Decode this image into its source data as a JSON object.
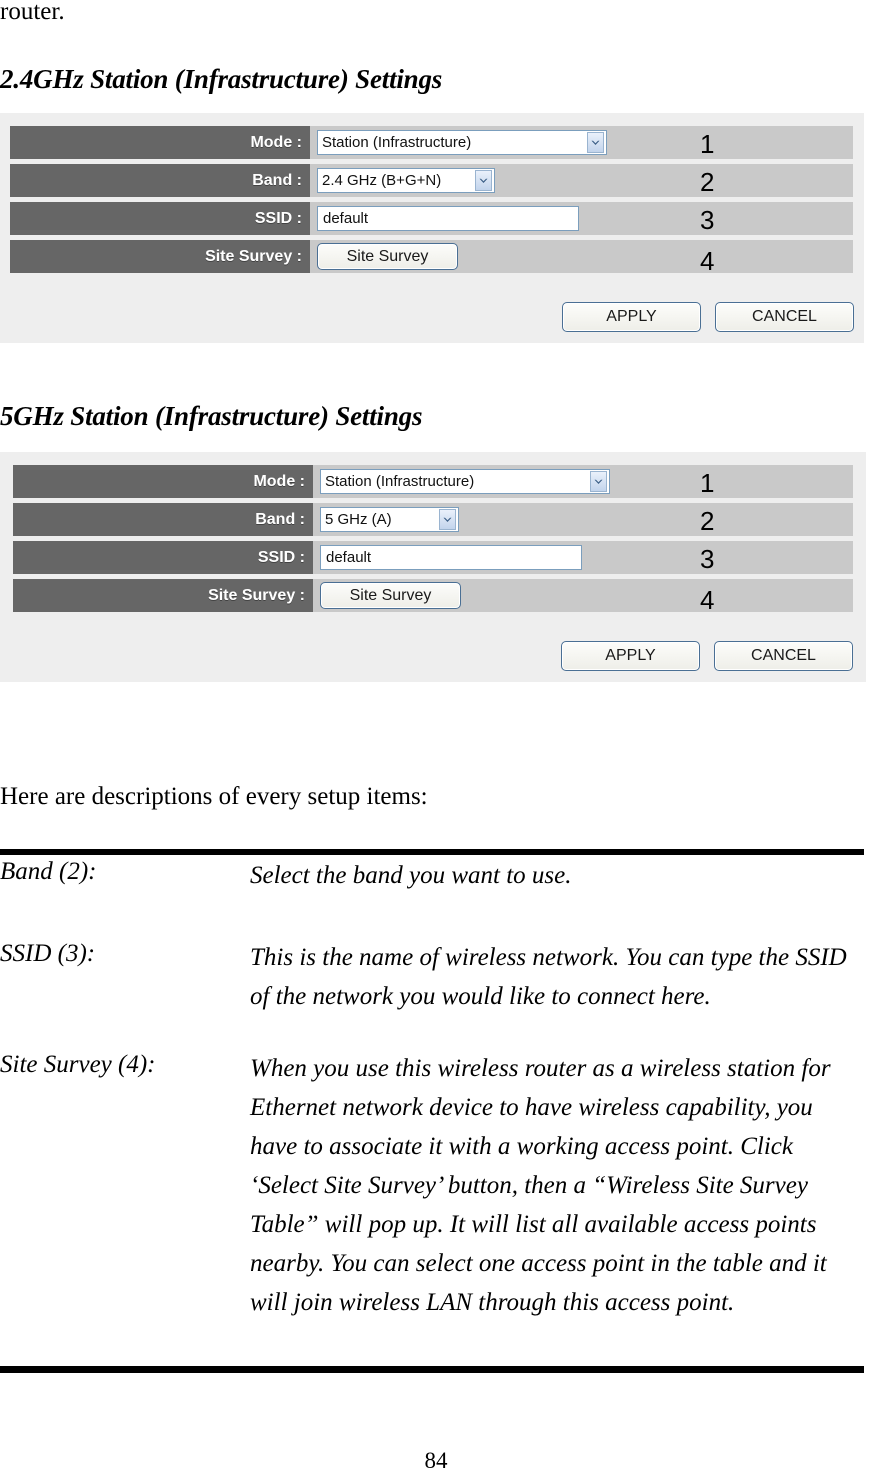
{
  "document": {
    "continued_text": "router.",
    "page_number": "84",
    "descriptions_intro": "Here are descriptions of every setup items:"
  },
  "sections": [
    {
      "heading": "2.4GHz Station (Infrastructure) Settings",
      "rows": [
        {
          "label": "Mode :",
          "control": "select",
          "value": "Station (Infrastructure)",
          "callout": "1",
          "control_width": 290
        },
        {
          "label": "Band :",
          "control": "select",
          "value": "2.4 GHz (B+G+N)",
          "callout": "2",
          "control_width": 178
        },
        {
          "label": "SSID :",
          "control": "text",
          "value": "default",
          "callout": "3",
          "control_width": 262
        },
        {
          "label": "Site Survey :",
          "control": "button",
          "value": "Site Survey",
          "callout": "4",
          "control_width": 141
        }
      ],
      "actions": {
        "apply_label": "APPLY",
        "cancel_label": "CANCEL"
      }
    },
    {
      "heading": "5GHz Station (Infrastructure) Settings",
      "rows": [
        {
          "label": "Mode :",
          "control": "select",
          "value": "Station (Infrastructure)",
          "callout": "1",
          "control_width": 290
        },
        {
          "label": "Band :",
          "control": "select",
          "value": "5 GHz (A)",
          "callout": "2",
          "control_width": 139
        },
        {
          "label": "SSID :",
          "control": "text",
          "value": "default",
          "callout": "3",
          "control_width": 262
        },
        {
          "label": "Site Survey :",
          "control": "button",
          "value": "Site Survey",
          "callout": "4",
          "control_width": 141
        }
      ],
      "actions": {
        "apply_label": "APPLY",
        "cancel_label": "CANCEL"
      }
    }
  ],
  "descriptions": [
    {
      "term": "Band (2):",
      "definition": "Select the band you want to use."
    },
    {
      "term": "SSID (3):",
      "definition": "This is the name of wireless network. You can type the SSID of the network you would like to connect here."
    },
    {
      "term": "Site Survey (4):",
      "definition": "When you use this wireless router as a wireless station for Ethernet network device to have wireless capability, you have to associate it with a working access point. Click ‘Select Site Survey’ button, then a “Wireless Site Survey Table” will pop up. It will list all available access points nearby. You can select one access point in the table and it will join wireless LAN through this access point."
    }
  ],
  "colors": {
    "panel_background": "#eeeeee",
    "label_cell": "#666666",
    "value_cell": "#c9c9c9",
    "field_border": "#7b9ebd",
    "button_border": "#4a6f94",
    "rule": "#000000"
  }
}
